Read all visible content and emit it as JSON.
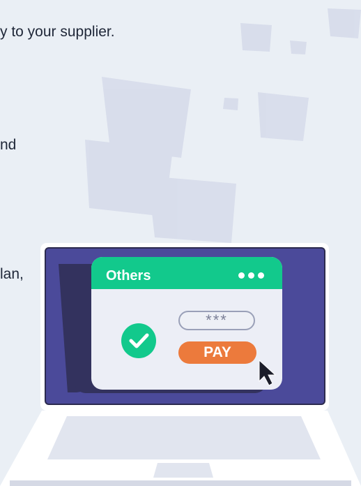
{
  "text": {
    "line_1": "y to your supplier.",
    "line_2": "nd",
    "line_3": "lan,"
  },
  "payment_window": {
    "title": "Others",
    "menu_icon": "more-dots-icon",
    "password_field_value": "***",
    "pay_button_label": "PAY",
    "status_icon": "check-circle-icon",
    "cursor_icon": "mouse-pointer-icon"
  },
  "colors": {
    "background": "#eaeff5",
    "screen": "#4b4a9a",
    "window_header": "#12c98c",
    "pay_button": "#ec7a3c",
    "check_circle": "#12c98c"
  }
}
